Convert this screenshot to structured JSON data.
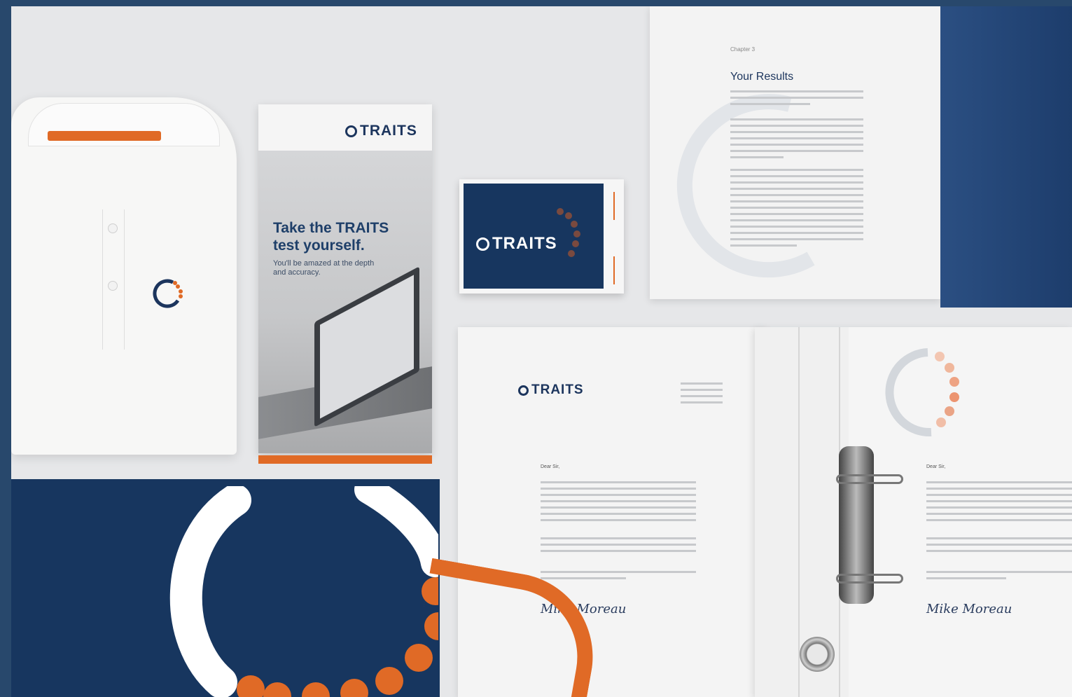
{
  "brand": {
    "logo_text": "TRAITS",
    "colors": {
      "navy": "#17365f",
      "orange": "#e06a26",
      "paper": "#f4f4f4"
    }
  },
  "brochure": {
    "headline_line1": "Take the TRAITS",
    "headline_line2": "test yourself.",
    "subtext_line1": "You'll be amazed at the depth",
    "subtext_line2": "and accuracy."
  },
  "book": {
    "chapter": "Chapter 3",
    "title": "Your Results"
  },
  "letterhead": {
    "greeting": "Dear Sir,",
    "signature": "Mike Moreau"
  }
}
